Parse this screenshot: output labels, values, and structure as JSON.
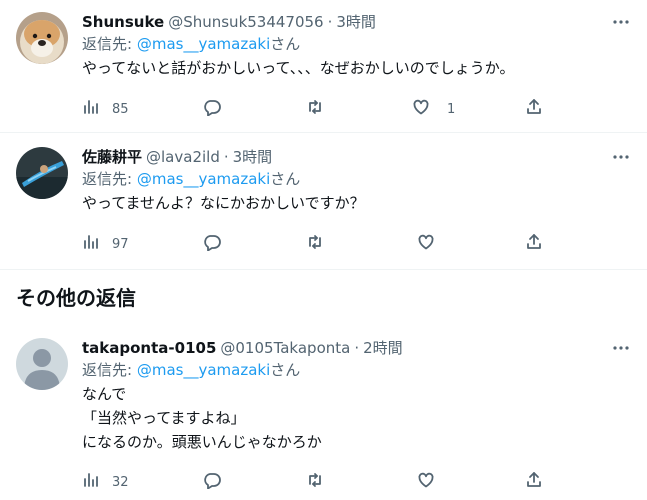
{
  "reply_prefix": "返信先: ",
  "reply_suffix": "さん",
  "tweets": [
    {
      "name": "Shunsuke",
      "handle": "@Shunsuk53447056",
      "dot": "·",
      "time": "3時間",
      "reply_to": "@mas__yamazaki",
      "text": [
        "やってないと話がおかしいって、、、なぜおかしいのでしょうか。"
      ],
      "views": "85",
      "likes": "1"
    },
    {
      "name": "佐藤耕平",
      "handle": "@lava2ild",
      "dot": "·",
      "time": "3時間",
      "reply_to": "@mas__yamazaki",
      "text": [
        "やってませんよ？なにかおかしいですか？"
      ],
      "views": "97"
    },
    {
      "name": "takaponta-0105",
      "handle": "@0105Takaponta",
      "dot": "·",
      "time": "2時間",
      "reply_to": "@mas__yamazaki",
      "text": [
        "なんで",
        "「当然やってますよね」",
        "になるのか。頭悪いんじゃなかろか"
      ],
      "views": "32"
    }
  ],
  "section_title": "その他の返信",
  "colors": {
    "accent": "#1d9bf0",
    "muted": "#536471",
    "text": "#0f1419",
    "divider": "#eff3f4"
  },
  "icons": [
    "more-icon",
    "views-icon",
    "reply-icon",
    "retweet-icon",
    "like-icon",
    "share-icon"
  ]
}
